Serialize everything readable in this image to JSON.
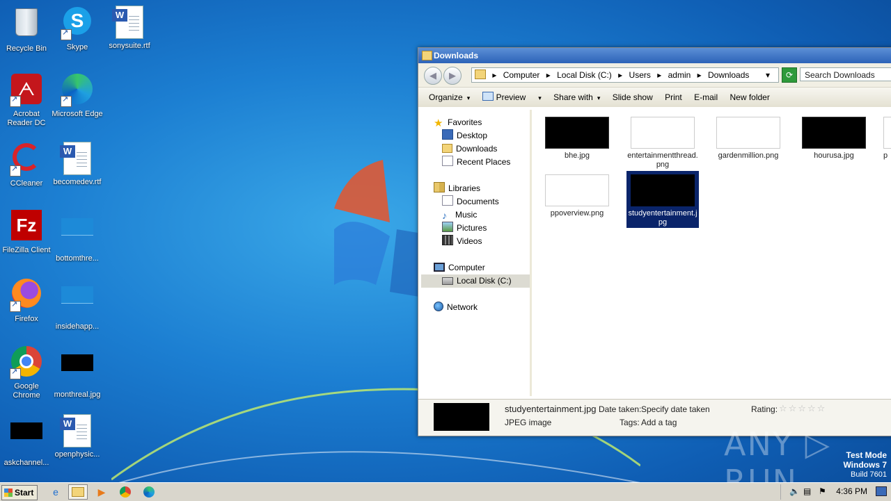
{
  "desktop": {
    "icons": [
      {
        "label": "Recycle Bin"
      },
      {
        "label": "Skype"
      },
      {
        "label": "sonysuite.rtf"
      },
      {
        "label": "Acrobat Reader DC"
      },
      {
        "label": "Microsoft Edge"
      },
      {
        "label": "CCleaner"
      },
      {
        "label": "becomedev.rtf"
      },
      {
        "label": "FileZilla Client"
      },
      {
        "label": "bottomthre..."
      },
      {
        "label": "Firefox"
      },
      {
        "label": "insidehapp..."
      },
      {
        "label": "Google Chrome"
      },
      {
        "label": "monthreal.jpg"
      },
      {
        "label": "askchannel..."
      },
      {
        "label": "openphysic..."
      }
    ]
  },
  "window": {
    "title": "Downloads",
    "nav": {
      "back": "◀",
      "forward": "▶"
    },
    "address": {
      "crumbs": [
        "Computer",
        "Local Disk (C:)",
        "Users",
        "admin",
        "Downloads"
      ],
      "separator": "▸",
      "dropdown": "▾"
    },
    "search_placeholder": "Search Downloads",
    "toolbar": {
      "organize": "Organize",
      "preview": "Preview",
      "share_with": "Share with",
      "slide_show": "Slide show",
      "print": "Print",
      "email": "E-mail",
      "new_folder": "New folder",
      "arrow": "▾"
    },
    "nav_pane": {
      "favorites": "Favorites",
      "desktop": "Desktop",
      "downloads": "Downloads",
      "recent_places": "Recent Places",
      "libraries": "Libraries",
      "documents": "Documents",
      "music": "Music",
      "pictures": "Pictures",
      "videos": "Videos",
      "computer": "Computer",
      "local_disk": "Local Disk (C:)",
      "network": "Network"
    },
    "files": [
      {
        "name": "bhe.jpg",
        "thumb": "black"
      },
      {
        "name": "entertainmentthread.png",
        "thumb": "white"
      },
      {
        "name": "gardenmillion.png",
        "thumb": "white"
      },
      {
        "name": "hourusa.jpg",
        "thumb": "black"
      },
      {
        "name": "p",
        "thumb": "white"
      },
      {
        "name": "ppoverview.png",
        "thumb": "white"
      },
      {
        "name": "studyentertainment.jpg",
        "thumb": "black",
        "selected": true
      }
    ],
    "details": {
      "filename": "studyentertainment.jpg",
      "filetype": "JPEG image",
      "date_label": "Date taken:",
      "date_value": "Specify date taken",
      "tags_label": "Tags:",
      "tags_value": "Add a tag",
      "rating_label": "Rating:",
      "stars": "☆☆☆☆☆"
    }
  },
  "watermark": {
    "brand": "ANY ▷ RUN",
    "test_mode": "Test Mode",
    "os": "Windows 7",
    "build": "Build 7601"
  },
  "taskbar": {
    "start": "Start",
    "clock": "4:36 PM"
  }
}
